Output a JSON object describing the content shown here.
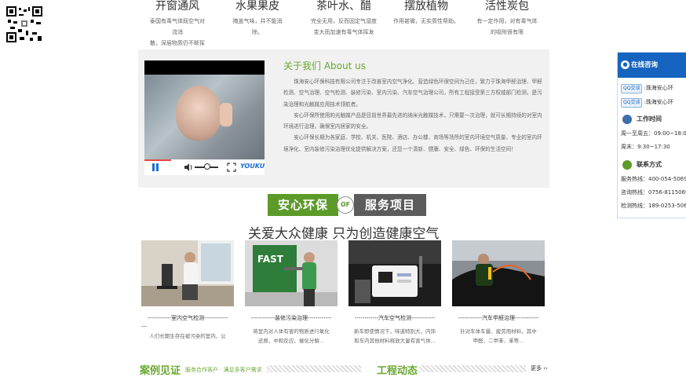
{
  "tips": [
    {
      "title": "开窗通风",
      "desc1": "泰国有毒气体既空气对流消",
      "desc2": "散，深层物质仍不断挥发"
    },
    {
      "title": "水果果皮",
      "desc1": "掩盖气味，并不能消除。",
      "desc2": ""
    },
    {
      "title": "茶叶水、醋",
      "desc1": "完全无用，反而固定气湿度",
      "desc2": "变大而加速有毒气体挥发"
    },
    {
      "title": "摆放植物",
      "desc1": "作用甚微，无实质性帮助。",
      "desc2": ""
    },
    {
      "title": "活性炭包",
      "desc1": "有一定作用，对有毒气体",
      "desc2": "的吸附很有限"
    }
  ],
  "about": {
    "title": "关于我们 About us",
    "p1": "珠海安心环保科技有限公司专注于改善室内空气净化、营造绿色环保空间为己任，致力于珠海甲醛治理、甲醛检测、空气治理、空气检测、装修污染、室内污染、汽车空气治理公司，所有工程接受第三方权威部门检测，是污染治理和光触媒应用技术领航者。",
    "p2": "安心环保所使用的光触媒产品是目前世界最先进的纳米光触媒技术，只需要一次治理，就可长期持续的对室内环境进行治理，确保室内居家的安全。",
    "p3": "安心环保长期为各家庭、学校、机关、医院、酒店、办公楼、商场等场所的室内环境空气质量、专业的室内环境净化、室内装修污染治理优化提供解决方案，还您一个清新、健康、安全、绿色、环保的生活空间！"
  },
  "video": {
    "brand": "YOUKU"
  },
  "banner": {
    "left": "安心环保",
    "of": "OF",
    "right": "服务项目"
  },
  "slogan": "关爱大众健康 只为创造健康空气",
  "services": [
    {
      "title": "------------室内空气检测------------",
      "title2": "---",
      "desc1": "人们长期生存在被污染的室内、公",
      "desc2": ""
    },
    {
      "title": "------------装修污染治理------------",
      "title2": "",
      "desc1": "将室内对人体有害的物质进行氧化",
      "desc2": "还原、中和反应、催化分解..."
    },
    {
      "title": "------------汽车空气检测------------",
      "title2": "",
      "desc1": "新车即使情况下，味道特别大，内饰",
      "desc2": "和车内其他材料释放大量有害气体..."
    },
    {
      "title": "------------汽车甲醛治理------------",
      "title2": "",
      "desc1": "针对车体车量、疲劳用材料，其中",
      "desc2": "甲醛、二甲苯、苯等..."
    }
  ],
  "footer": {
    "left": "案例见证",
    "left_sub": "服务合作客户 · 满足多客户需求",
    "middle": "工程动态",
    "more": "更多"
  },
  "sidebar": {
    "header": "在线咨询",
    "qq_label": "QQ交谈",
    "qq_rows": [
      "珠海安心环",
      "珠海安心环"
    ],
    "hours_title": "工作时间",
    "hours": [
      "周一至周五：09:00~18:00",
      "周末：9:30~17:30"
    ],
    "contact_title": "联系方式",
    "contacts": [
      "服务热线：400-054-5069",
      "咨询热线：0756-8115069",
      "检测热线：189-0253-5069"
    ]
  }
}
